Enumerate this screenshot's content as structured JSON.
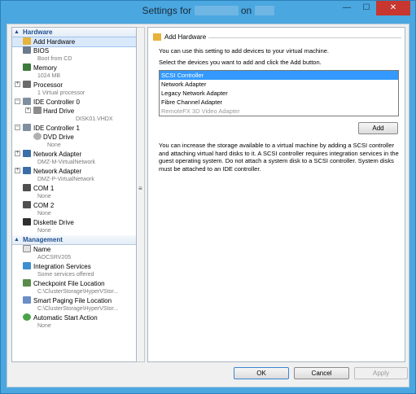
{
  "window": {
    "title_prefix": "Settings for",
    "title_middle": "on",
    "minimize_glyph": "—",
    "maximize_glyph": "☐",
    "close_glyph": "✕"
  },
  "tree": {
    "hardware_header": "Hardware",
    "management_header": "Management",
    "hardware": [
      {
        "label": "Add Hardware",
        "sub": ""
      },
      {
        "label": "BIOS",
        "sub": "Boot from CD"
      },
      {
        "label": "Memory",
        "sub": "1024 MB"
      },
      {
        "label": "Processor",
        "sub": "1 Virtual processor"
      },
      {
        "label": "IDE Controller 0",
        "sub": ""
      },
      {
        "label": "Hard Drive",
        "sub": "DISK01.VHDX"
      },
      {
        "label": "IDE Controller 1",
        "sub": ""
      },
      {
        "label": "DVD Drive",
        "sub": "None"
      },
      {
        "label": "Network Adapter",
        "sub": "DMZ-M-VirtualNetwork"
      },
      {
        "label": "Network Adapter",
        "sub": "DMZ-P-VirtualNetwork"
      },
      {
        "label": "COM 1",
        "sub": "None"
      },
      {
        "label": "COM 2",
        "sub": "None"
      },
      {
        "label": "Diskette Drive",
        "sub": "None"
      }
    ],
    "management": [
      {
        "label": "Name",
        "sub": "AOCSRV205"
      },
      {
        "label": "Integration Services",
        "sub": "Some services offered"
      },
      {
        "label": "Checkpoint File Location",
        "sub": "C:\\ClusterStorage\\HyperVStor..."
      },
      {
        "label": "Smart Paging File Location",
        "sub": "C:\\ClusterStorage\\HyperVStor..."
      },
      {
        "label": "Automatic Start Action",
        "sub": "None"
      }
    ]
  },
  "panel": {
    "title": "Add Hardware",
    "intro": "You can use this setting to add devices to your virtual machine.",
    "instruction": "Select the devices you want to add and click the Add button.",
    "devices": [
      "SCSI Controller",
      "Network Adapter",
      "Legacy Network Adapter",
      "Fibre Channel Adapter",
      "RemoteFX 3D Video Adapter"
    ],
    "add_button": "Add",
    "description": "You can increase the storage available to a virtual machine by adding a SCSI controller and attaching virtual hard disks to it. A SCSI controller requires integration services in the guest operating system. Do not attach a system disk to a SCSI controller. System disks must be attached to an IDE controller."
  },
  "footer": {
    "ok": "OK",
    "cancel": "Cancel",
    "apply": "Apply"
  }
}
